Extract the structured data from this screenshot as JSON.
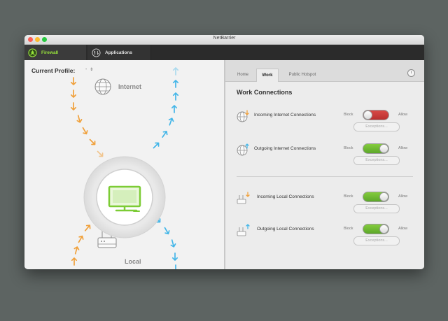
{
  "window": {
    "title": "NetBarrier"
  },
  "toolbar": {
    "tabs": [
      {
        "label": "Firewall"
      },
      {
        "label": "Applications"
      }
    ]
  },
  "left_panel": {
    "current_profile_label": "Current Profile:",
    "profile_value": "-",
    "internet_label": "Internet",
    "local_label": "Local"
  },
  "right_panel": {
    "tabs": [
      {
        "label": "Home"
      },
      {
        "label": "Work"
      },
      {
        "label": "Public Hotspot"
      }
    ],
    "active_tab": "Work",
    "heading": "Work Connections",
    "block_label": "Block",
    "allow_label": "Allow",
    "rows": [
      {
        "label": "Incoming Internet Connections",
        "state": "block",
        "exceptions_label": "Exceptions..."
      },
      {
        "label": "Outgoing Internet Connections",
        "state": "allow",
        "exceptions_label": "Exceptions..."
      },
      {
        "label": "Incoming Local Connections",
        "state": "allow",
        "exceptions_label": "Exceptions..."
      },
      {
        "label": "Outgoing Local Connections",
        "state": "allow",
        "exceptions_label": "Exceptions..."
      }
    ]
  },
  "colors": {
    "accent_green": "#8ad03f",
    "toggle_red": "#c93a37",
    "arrow_orange": "#f0a13c",
    "arrow_blue": "#44b6e8",
    "toolbar_bg": "#2b2b2b",
    "desktop_bg": "#5d6462"
  }
}
